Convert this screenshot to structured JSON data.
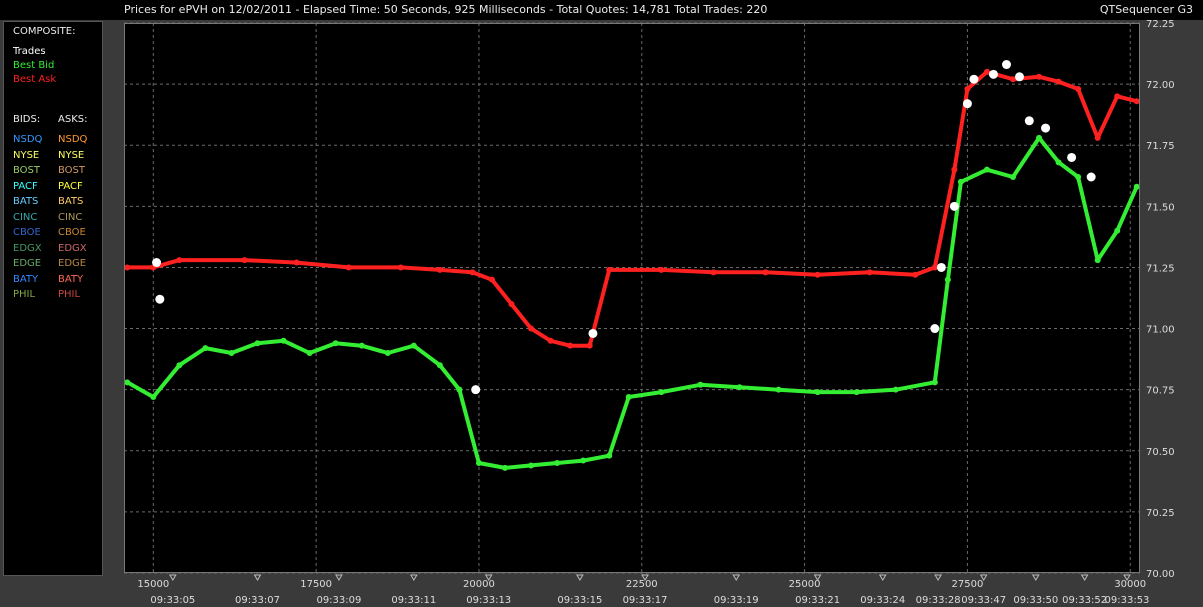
{
  "window": {
    "title": "Prices for  ePVH  on  12/02/2011  -  Elapsed Time: 50 Seconds, 925 Milliseconds  -  Total Quotes: 14,781  Total Trades: 220",
    "app_name": "QTSequencer G3"
  },
  "legend": {
    "composite_header": "COMPOSITE:",
    "composite": [
      {
        "label": "Trades",
        "color": "#ffffff"
      },
      {
        "label": "Best Bid",
        "color": "#33ee33"
      },
      {
        "label": "Best Ask",
        "color": "#ff2020"
      }
    ],
    "bids_header": "BIDS:",
    "asks_header": "ASKS:",
    "exchanges": [
      {
        "bid": "NSDQ",
        "bid_color": "#3399ff",
        "ask": "NSDQ",
        "ask_color": "#ff9933"
      },
      {
        "bid": "NYSE",
        "bid_color": "#ffff66",
        "ask": "NYSE",
        "ask_color": "#ffff66"
      },
      {
        "bid": "BOST",
        "bid_color": "#99cc66",
        "ask": "BOST",
        "ask_color": "#cc9966"
      },
      {
        "bid": "PACF",
        "bid_color": "#33ffff",
        "ask": "PACF",
        "ask_color": "#ffff33"
      },
      {
        "bid": "BATS",
        "bid_color": "#66ccff",
        "ask": "BATS",
        "ask_color": "#ffcc66"
      },
      {
        "bid": "CINC",
        "bid_color": "#33aaaa",
        "ask": "CINC",
        "ask_color": "#aa9955"
      },
      {
        "bid": "CBOE",
        "bid_color": "#3366cc",
        "ask": "CBOE",
        "ask_color": "#cc8833"
      },
      {
        "bid": "EDGX",
        "bid_color": "#449966",
        "ask": "EDGX",
        "ask_color": "#cc6666"
      },
      {
        "bid": "EDGE",
        "bid_color": "#66aa66",
        "ask": "EDGE",
        "ask_color": "#bb8844"
      },
      {
        "bid": "BATY",
        "bid_color": "#3388ff",
        "ask": "BATY",
        "ask_color": "#ff6655"
      },
      {
        "bid": "PHIL",
        "bid_color": "#88aa44",
        "ask": "PHIL",
        "ask_color": "#cc4444"
      }
    ]
  },
  "chart_data": {
    "type": "line",
    "title": "Prices for  ePVH  on  12/02/2011",
    "ylim": [
      70.0,
      72.25
    ],
    "y_ticks": [
      "72.25",
      "72.00",
      "71.75",
      "71.50",
      "71.25",
      "71.00",
      "70.75",
      "70.50",
      "70.25",
      "70.00"
    ],
    "xlim": [
      14550,
      30150
    ],
    "x_ticks": [
      {
        "x": 15000,
        "label": "15000"
      },
      {
        "x": 17500,
        "label": "17500"
      },
      {
        "x": 20000,
        "label": "20000"
      },
      {
        "x": 22500,
        "label": "22500"
      },
      {
        "x": 25000,
        "label": "25000"
      },
      {
        "x": 27500,
        "label": "27500"
      },
      {
        "x": 30000,
        "label": "30000"
      }
    ],
    "time_labels": [
      {
        "x": 15300,
        "label": "09:33:05"
      },
      {
        "x": 16600,
        "label": "09:33:07"
      },
      {
        "x": 17850,
        "label": "09:33:09"
      },
      {
        "x": 19000,
        "label": "09:33:11"
      },
      {
        "x": 20150,
        "label": "09:33:13"
      },
      {
        "x": 21550,
        "label": "09:33:15"
      },
      {
        "x": 22550,
        "label": "09:33:17"
      },
      {
        "x": 23950,
        "label": "09:33:19"
      },
      {
        "x": 25200,
        "label": "09:33:21"
      },
      {
        "x": 26200,
        "label": "09:33:24"
      },
      {
        "x": 27050,
        "label": "09:33:28"
      },
      {
        "x": 27750,
        "label": "09:33:47"
      },
      {
        "x": 28550,
        "label": "09:33:50"
      },
      {
        "x": 29300,
        "label": "09:33:52"
      },
      {
        "x": 29950,
        "label": "09:33:53"
      }
    ],
    "grid": true,
    "series": [
      {
        "name": "Best Ask",
        "color": "#ff2020",
        "points": [
          [
            14600,
            71.25
          ],
          [
            15000,
            71.25
          ],
          [
            15400,
            71.28
          ],
          [
            16400,
            71.28
          ],
          [
            17200,
            71.27
          ],
          [
            18000,
            71.25
          ],
          [
            18800,
            71.25
          ],
          [
            19400,
            71.24
          ],
          [
            19900,
            71.23
          ],
          [
            20200,
            71.2
          ],
          [
            20500,
            71.1
          ],
          [
            20800,
            71.0
          ],
          [
            21100,
            70.95
          ],
          [
            21400,
            70.93
          ],
          [
            21700,
            70.93
          ],
          [
            22000,
            71.24
          ],
          [
            22800,
            71.24
          ],
          [
            23600,
            71.23
          ],
          [
            24400,
            71.23
          ],
          [
            25200,
            71.22
          ],
          [
            26000,
            71.23
          ],
          [
            26700,
            71.22
          ],
          [
            27000,
            71.25
          ],
          [
            27300,
            71.65
          ],
          [
            27500,
            71.98
          ],
          [
            27800,
            72.05
          ],
          [
            28200,
            72.02
          ],
          [
            28600,
            72.03
          ],
          [
            28900,
            72.01
          ],
          [
            29200,
            71.98
          ],
          [
            29500,
            71.78
          ],
          [
            29800,
            71.95
          ],
          [
            30100,
            71.93
          ]
        ]
      },
      {
        "name": "Best Bid",
        "color": "#33ee33",
        "points": [
          [
            14600,
            70.78
          ],
          [
            15000,
            70.72
          ],
          [
            15400,
            70.85
          ],
          [
            15800,
            70.92
          ],
          [
            16200,
            70.9
          ],
          [
            16600,
            70.94
          ],
          [
            17000,
            70.95
          ],
          [
            17400,
            70.9
          ],
          [
            17800,
            70.94
          ],
          [
            18200,
            70.93
          ],
          [
            18600,
            70.9
          ],
          [
            19000,
            70.93
          ],
          [
            19400,
            70.85
          ],
          [
            19700,
            70.75
          ],
          [
            20000,
            70.45
          ],
          [
            20400,
            70.43
          ],
          [
            20800,
            70.44
          ],
          [
            21200,
            70.45
          ],
          [
            21600,
            70.46
          ],
          [
            22000,
            70.48
          ],
          [
            22300,
            70.72
          ],
          [
            22800,
            70.74
          ],
          [
            23400,
            70.77
          ],
          [
            24000,
            70.76
          ],
          [
            24600,
            70.75
          ],
          [
            25200,
            70.74
          ],
          [
            25800,
            70.74
          ],
          [
            26400,
            70.75
          ],
          [
            27000,
            70.78
          ],
          [
            27200,
            71.2
          ],
          [
            27400,
            71.6
          ],
          [
            27800,
            71.65
          ],
          [
            28200,
            71.62
          ],
          [
            28600,
            71.78
          ],
          [
            28900,
            71.68
          ],
          [
            29200,
            71.62
          ],
          [
            29500,
            71.28
          ],
          [
            29800,
            71.4
          ],
          [
            30100,
            71.58
          ]
        ]
      },
      {
        "name": "Trades",
        "color": "#ffffff",
        "points": [
          [
            15050,
            71.27
          ],
          [
            15100,
            71.12
          ],
          [
            19950,
            70.75
          ],
          [
            21750,
            70.98
          ],
          [
            27000,
            71.0
          ],
          [
            27100,
            71.25
          ],
          [
            27300,
            71.5
          ],
          [
            27500,
            71.92
          ],
          [
            27600,
            72.02
          ],
          [
            27900,
            72.04
          ],
          [
            28100,
            72.08
          ],
          [
            28300,
            72.03
          ],
          [
            28450,
            71.85
          ],
          [
            28700,
            71.82
          ],
          [
            29100,
            71.7
          ],
          [
            29400,
            71.62
          ]
        ]
      }
    ]
  }
}
